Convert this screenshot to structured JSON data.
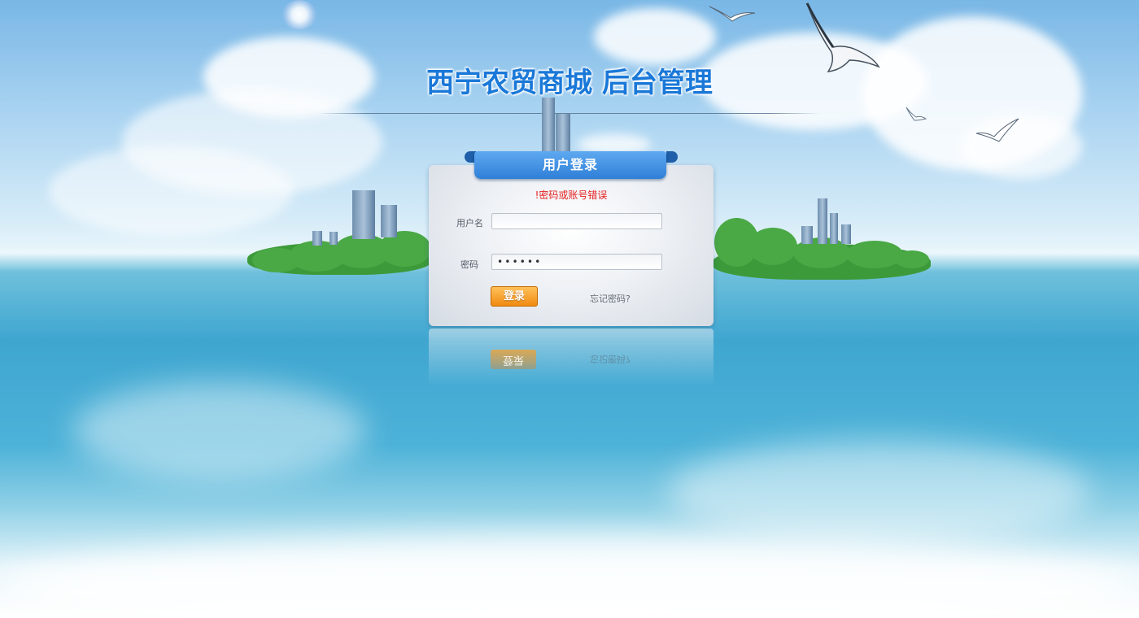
{
  "page": {
    "title": "西宁农贸商城 后台管理"
  },
  "login": {
    "header": "用户登录",
    "error_message": "!密码或账号错误",
    "username_label": "用户名",
    "username_value": "",
    "password_label": "密码",
    "password_value": "••••••",
    "submit_label": "登录",
    "forgot_label": "忘记密码?"
  },
  "colors": {
    "title": "#1a78d8",
    "ribbon": "#2f7fd8",
    "error": "#e52020",
    "button": "#f08a10"
  },
  "icons": [
    "seagull-icon"
  ]
}
